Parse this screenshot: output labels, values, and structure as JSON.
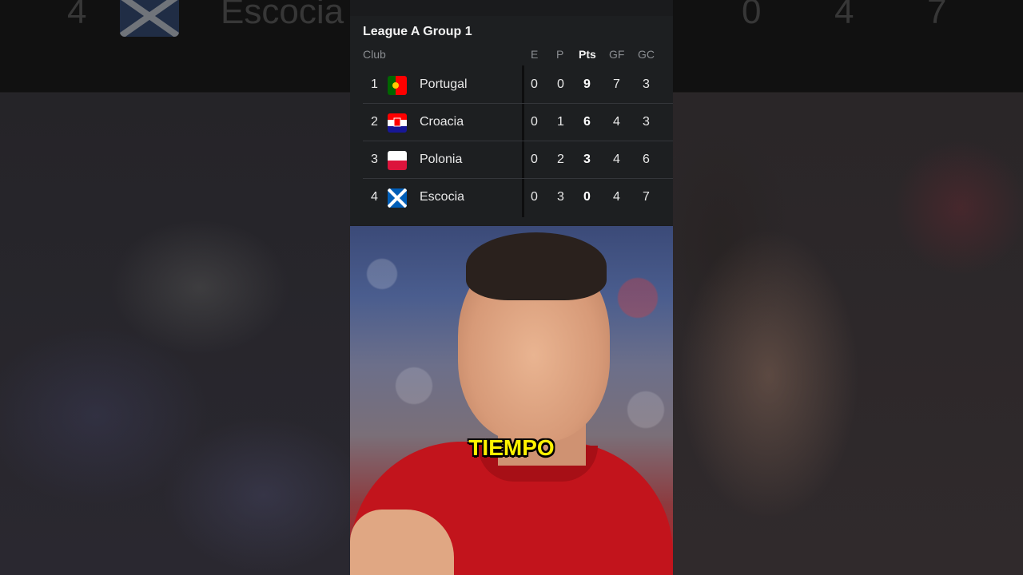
{
  "background_ghost": {
    "position": "4",
    "club": "Escocia",
    "values": [
      "0",
      "4",
      "7"
    ]
  },
  "standings": {
    "title": "League A Group 1",
    "columns": {
      "club": "Club",
      "e": "E",
      "p": "P",
      "pts": "Pts",
      "gf": "GF",
      "gc": "GC"
    },
    "rows": [
      {
        "pos": "1",
        "club": "Portugal",
        "flag": "portugal-flag",
        "e": "0",
        "p": "0",
        "pts": "9",
        "gf": "7",
        "gc": "3"
      },
      {
        "pos": "2",
        "club": "Croacia",
        "flag": "croatia-flag",
        "e": "0",
        "p": "1",
        "pts": "6",
        "gf": "4",
        "gc": "3"
      },
      {
        "pos": "3",
        "club": "Polonia",
        "flag": "poland-flag",
        "e": "0",
        "p": "2",
        "pts": "3",
        "gf": "4",
        "gc": "6"
      },
      {
        "pos": "4",
        "club": "Escocia",
        "flag": "scotland-flag",
        "e": "0",
        "p": "3",
        "pts": "0",
        "gf": "4",
        "gc": "7"
      }
    ]
  },
  "caption": "TIEMPO",
  "colors": {
    "caption": "#fff200",
    "shirt": "#c2141c",
    "panel": "#1d1f21"
  }
}
